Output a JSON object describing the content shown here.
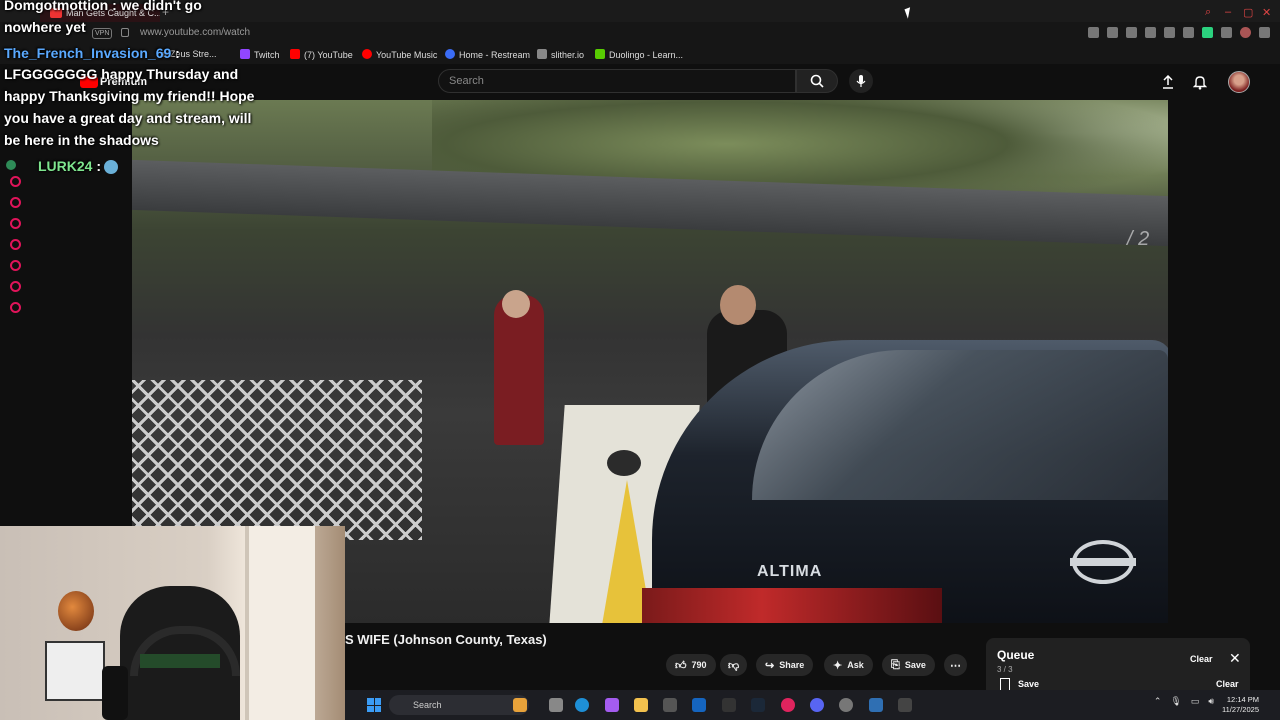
{
  "browser": {
    "tab_title": "Man Gets Caught & C...",
    "url": "www.youtube.com/watch",
    "vpn_label": "VPN",
    "bookmarks": [
      "adZeus Stre...",
      "Twitch",
      "(7) YouTube",
      "YouTube Music",
      "Home - Restream",
      "slither.io",
      "Duolingo - Learn..."
    ]
  },
  "youtube": {
    "brand": "Premium",
    "search_placeholder": "Search",
    "video_title": "S WIFE (Johnson County, Texas)",
    "likes": "790",
    "share_label": "Share",
    "ask_label": "Ask",
    "save_label": "Save",
    "watermark": "/ 2",
    "car_text": "ALTIMA"
  },
  "queue": {
    "title": "Queue",
    "count": "3 / 3",
    "clear_label": "Clear",
    "save_label": "Save",
    "clear2_label": "Clear"
  },
  "chat": [
    {
      "user": "Domgotmottion",
      "text": " : we didn't go"
    },
    {
      "user": "",
      "text": "nowhere yet"
    },
    {
      "user": "The_French_Invasion_69",
      "text": " :"
    },
    {
      "user": "",
      "text": "LFGGGGGGG happy Thursday and"
    },
    {
      "user": "",
      "text": "happy Thanksgiving my friend!! Hope"
    },
    {
      "user": "",
      "text": "you have a great day and stream, will"
    },
    {
      "user": "",
      "text": "be here in the shadows"
    },
    {
      "user": "LURK24",
      "text": " :"
    }
  ],
  "colors": {
    "chat_user1": "#ffffff",
    "chat_user2": "#5aa9ff",
    "chat_user3": "#7ee58e"
  },
  "taskbar": {
    "search_label": "Search",
    "time": "12:14 PM",
    "date": "11/27/2025"
  }
}
